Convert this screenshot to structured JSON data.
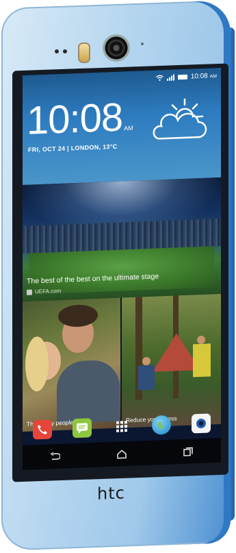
{
  "device": {
    "brand_logo": "htc"
  },
  "status_bar": {
    "time": "10:08",
    "ampm": "AM",
    "wifi": "wifi-icon",
    "signal": "signal-icon",
    "battery": "battery-icon"
  },
  "clock_widget": {
    "time": "10:08",
    "ampm": "AM",
    "date_location": "FRI, OCT 24 | LONDON, 13°C",
    "weather": "partly-cloudy-icon"
  },
  "news_card": {
    "headline": "The best of the best on the ultimate stage",
    "source": "UEFA.com"
  },
  "tiles": [
    {
      "caption": "The happy people"
    },
    {
      "caption": "Reduce your Stress"
    }
  ],
  "dock": [
    {
      "icon": "phone-icon"
    },
    {
      "icon": "messages-icon"
    },
    {
      "icon": "apps-grid-icon"
    },
    {
      "icon": "browser-globe-icon"
    },
    {
      "icon": "camera-app-icon"
    }
  ],
  "navbar": [
    "back-icon",
    "home-icon",
    "recents-icon"
  ],
  "colors": {
    "accent": "#2f79c4",
    "screen_blue": "#2d7cc0"
  }
}
